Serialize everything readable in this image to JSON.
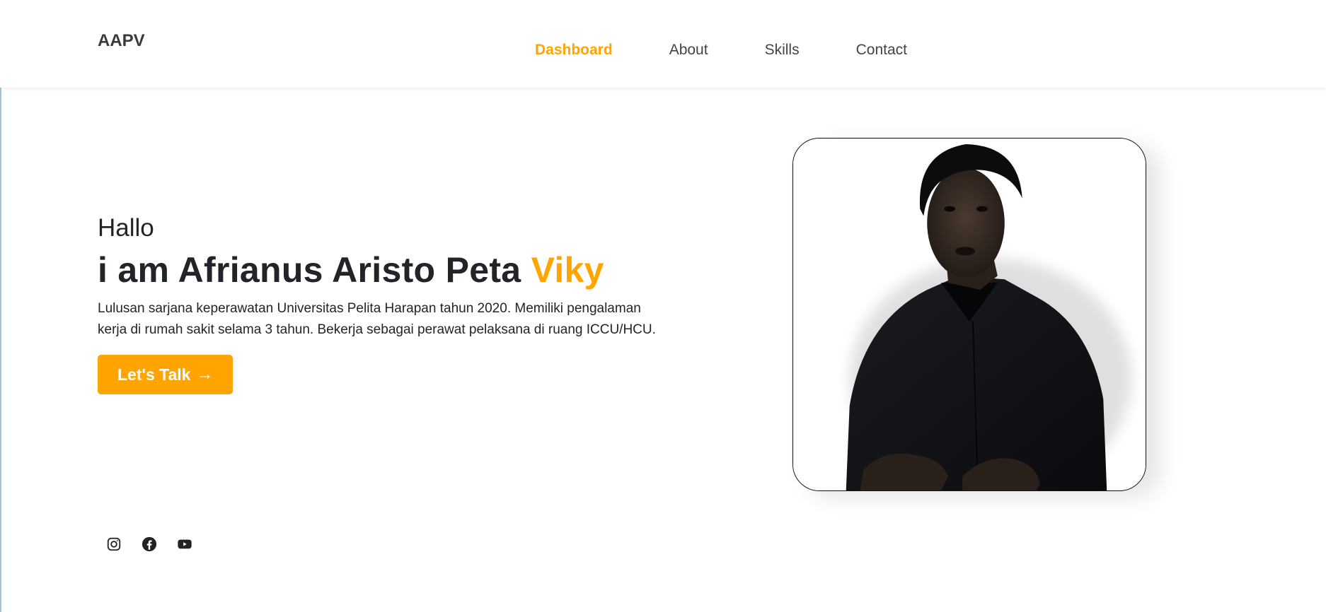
{
  "navbar": {
    "brand": "AAPV",
    "links": [
      {
        "label": "Dashboard",
        "active": true
      },
      {
        "label": "About",
        "active": false
      },
      {
        "label": "Skills",
        "active": false
      },
      {
        "label": "Contact",
        "active": false
      }
    ]
  },
  "hero": {
    "greeting": "Hallo",
    "title_prefix": "i am Afrianus Aristo Peta ",
    "title_accent": "Viky",
    "description": "Lulusan sarjana keperawatan Universitas Pelita Harapan tahun 2020. Memiliki pengalaman kerja di rumah sakit selama 3 tahun. Bekerja sebagai perawat pelaksana di ruang ICCU/HCU.",
    "cta_label": "Let's Talk",
    "cta_arrow": "→"
  },
  "socials": [
    {
      "icon": "instagram-icon"
    },
    {
      "icon": "facebook-icon"
    },
    {
      "icon": "youtube-icon"
    }
  ],
  "colors": {
    "accent": "#ffa400",
    "text": "#212529",
    "nav_text": "#444444"
  }
}
